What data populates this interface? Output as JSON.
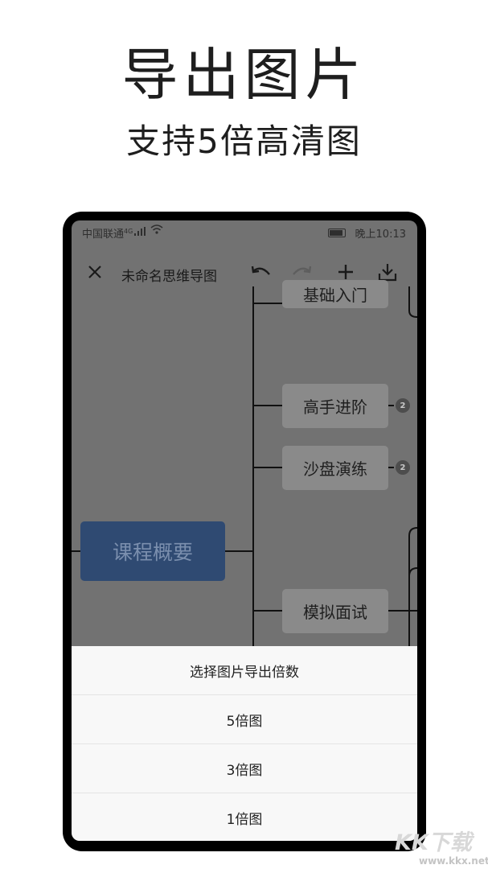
{
  "promo": {
    "title": "导出图片",
    "subtitle": "支持5倍高清图"
  },
  "status_bar": {
    "carrier": "中国联通",
    "network": "4G",
    "time": "晚上10:13"
  },
  "toolbar": {
    "title": "未命名思维导图",
    "icons": [
      "close-icon",
      "undo-icon",
      "redo-icon",
      "plus-icon",
      "download-icon"
    ]
  },
  "mindmap": {
    "root": "课程概要",
    "branches": [
      {
        "label": "基础入门",
        "count": ""
      },
      {
        "label": "高手进阶",
        "count": "2"
      },
      {
        "label": "沙盘演练",
        "count": "2"
      },
      {
        "label": "模拟面试",
        "count": ""
      }
    ]
  },
  "sheet": {
    "title": "选择图片导出倍数",
    "options": [
      "5倍图",
      "3倍图",
      "1倍图"
    ]
  },
  "watermark": {
    "logo": "KK下载",
    "url": "www.kkx.net"
  },
  "colors": {
    "root_node": "#2f4a72",
    "node": "#8a8a8a",
    "canvas_dim": "#727272",
    "sheet_bg": "#f8f8f8"
  }
}
